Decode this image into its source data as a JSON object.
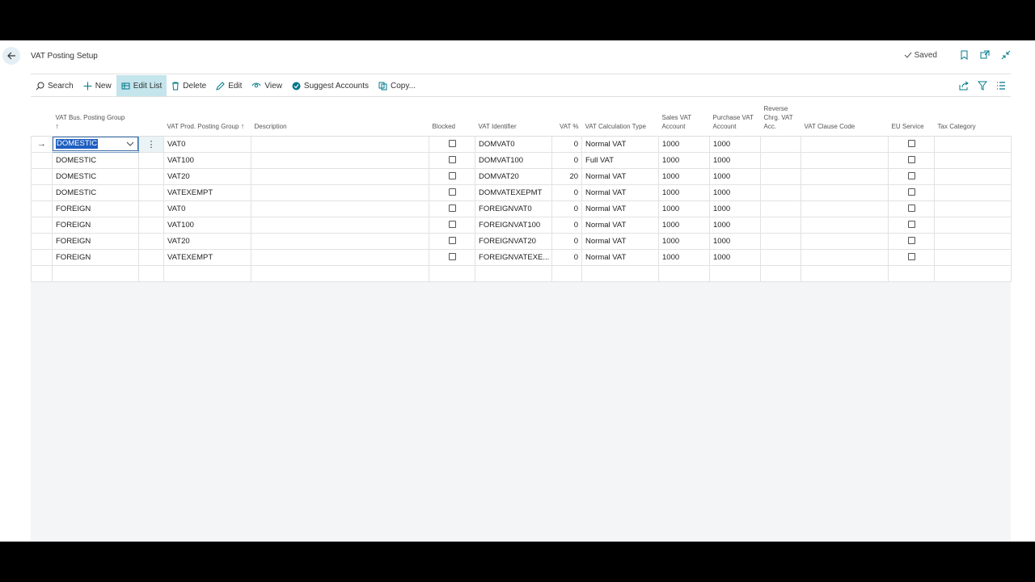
{
  "page": {
    "title": "VAT Posting Setup",
    "saved_label": "Saved"
  },
  "icons": {
    "back": "back-arrow-icon",
    "saved": "checkmark-icon",
    "bookmark": "bookmark-icon",
    "open_new": "open-in-new-window-icon",
    "collapse": "collapse-icon",
    "share": "share-icon",
    "filter": "filter-icon",
    "list": "list-view-icon"
  },
  "actions": {
    "search": "Search",
    "new": "New",
    "edit_list": "Edit List",
    "delete": "Delete",
    "edit": "Edit",
    "view": "View",
    "suggest": "Suggest Accounts",
    "copy": "Copy..."
  },
  "columns": {
    "bus_group": "VAT Bus. Posting Group",
    "prod_group": "VAT Prod. Posting Group",
    "description": "Description",
    "blocked": "Blocked",
    "identifier": "VAT Identifier",
    "vat_pct": "VAT %",
    "calc_type": "VAT Calculation Type",
    "sales_acc": "Sales VAT Account",
    "purch_acc": "Purchase VAT Account",
    "reverse": "Reverse Chrg. VAT Acc.",
    "clause": "VAT Clause Code",
    "eu_service": "EU Service",
    "tax_category": "Tax Category"
  },
  "rows": [
    {
      "bus": "DOMESTIC",
      "prod": "VAT0",
      "desc": "",
      "blocked": false,
      "ident": "DOMVAT0",
      "pct": "0",
      "calc": "Normal VAT",
      "sales": "1000",
      "purch": "1000",
      "reverse": "",
      "clause": "",
      "eu": false,
      "tax": ""
    },
    {
      "bus": "DOMESTIC",
      "prod": "VAT100",
      "desc": "",
      "blocked": false,
      "ident": "DOMVAT100",
      "pct": "0",
      "calc": "Full VAT",
      "sales": "1000",
      "purch": "1000",
      "reverse": "",
      "clause": "",
      "eu": false,
      "tax": ""
    },
    {
      "bus": "DOMESTIC",
      "prod": "VAT20",
      "desc": "",
      "blocked": false,
      "ident": "DOMVAT20",
      "pct": "20",
      "calc": "Normal VAT",
      "sales": "1000",
      "purch": "1000",
      "reverse": "",
      "clause": "",
      "eu": false,
      "tax": ""
    },
    {
      "bus": "DOMESTIC",
      "prod": "VATEXEMPT",
      "desc": "",
      "blocked": false,
      "ident": "DOMVATEXEPMT",
      "pct": "0",
      "calc": "Normal VAT",
      "sales": "1000",
      "purch": "1000",
      "reverse": "",
      "clause": "",
      "eu": false,
      "tax": ""
    },
    {
      "bus": "FOREIGN",
      "prod": "VAT0",
      "desc": "",
      "blocked": false,
      "ident": "FOREIGNVAT0",
      "pct": "0",
      "calc": "Normal VAT",
      "sales": "1000",
      "purch": "1000",
      "reverse": "",
      "clause": "",
      "eu": false,
      "tax": ""
    },
    {
      "bus": "FOREIGN",
      "prod": "VAT100",
      "desc": "",
      "blocked": false,
      "ident": "FOREIGNVAT100",
      "pct": "0",
      "calc": "Normal VAT",
      "sales": "1000",
      "purch": "1000",
      "reverse": "",
      "clause": "",
      "eu": false,
      "tax": ""
    },
    {
      "bus": "FOREIGN",
      "prod": "VAT20",
      "desc": "",
      "blocked": false,
      "ident": "FOREIGNVAT20",
      "pct": "0",
      "calc": "Normal VAT",
      "sales": "1000",
      "purch": "1000",
      "reverse": "",
      "clause": "",
      "eu": false,
      "tax": ""
    },
    {
      "bus": "FOREIGN",
      "prod": "VATEXEMPT",
      "desc": "",
      "blocked": false,
      "ident": "FOREIGNVATEXE...",
      "pct": "0",
      "calc": "Normal VAT",
      "sales": "1000",
      "purch": "1000",
      "reverse": "",
      "clause": "",
      "eu": false,
      "tax": ""
    }
  ],
  "colors": {
    "accent": "#1f5fc1",
    "active_action_bg": "#c4e5ec",
    "brand_teal": "#00788a"
  }
}
